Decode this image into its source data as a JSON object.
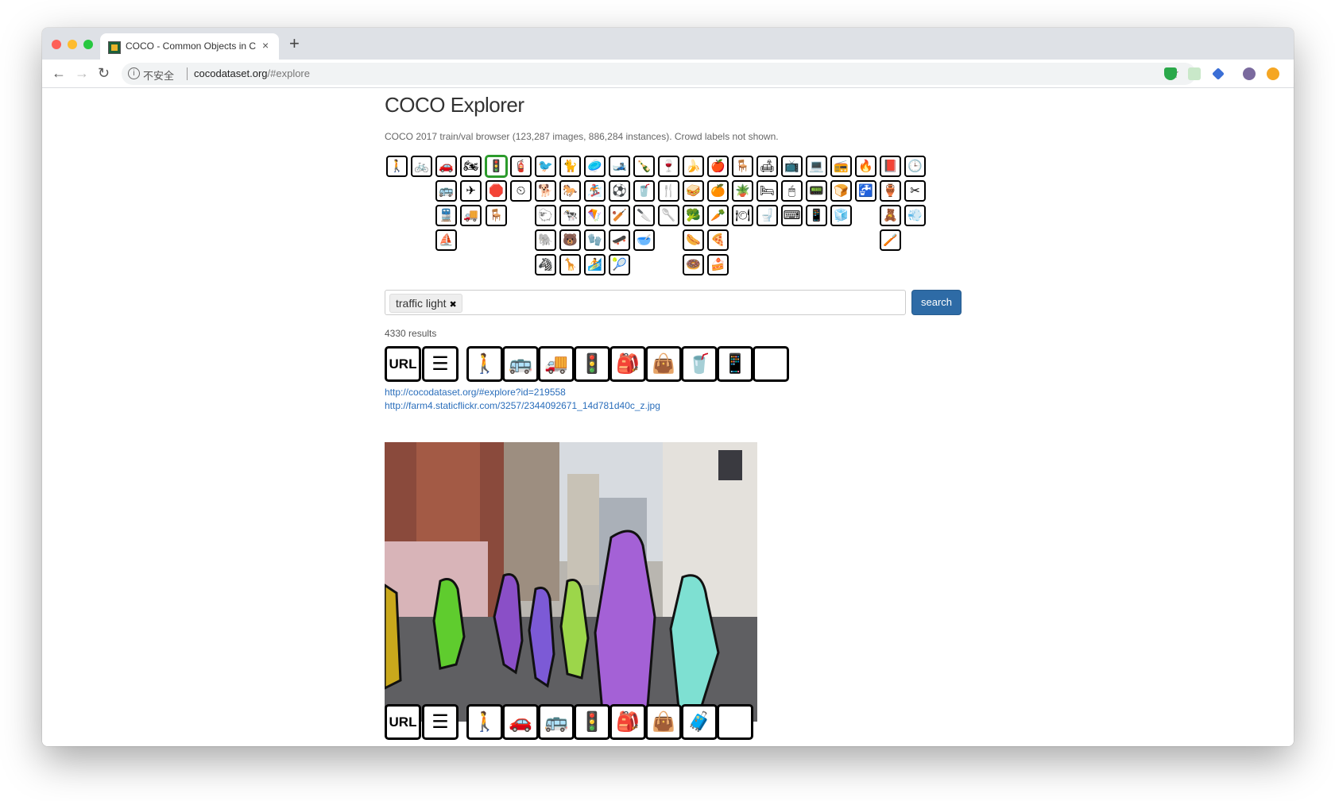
{
  "browser": {
    "tab_title": "COCO - Common Objects in C",
    "new_tab": "+",
    "tab_close": "×",
    "insecure_label": "不安全",
    "url_host": "cocodataset.org",
    "url_path": "/#explore"
  },
  "page": {
    "title": "COCO Explorer",
    "subtitle": "COCO 2017 train/val browser (123,287 images, 886,284 instances). Crowd labels not shown."
  },
  "categories": [
    {
      "name": "person",
      "icon": "🚶"
    },
    {
      "name": "bicycle",
      "icon": "🚲"
    },
    {
      "name": "car",
      "icon": "🚗"
    },
    {
      "name": "motorcycle",
      "icon": "🏍"
    },
    {
      "name": "airplane",
      "icon": "✈"
    },
    {
      "name": "bus",
      "icon": "🚌"
    },
    {
      "name": "train",
      "icon": "🚆"
    },
    {
      "name": "truck",
      "icon": "🚚"
    },
    {
      "name": "boat",
      "icon": "⛵"
    },
    {
      "name": "traffic light",
      "icon": "🚦",
      "selected": true
    },
    {
      "name": "fire hydrant",
      "icon": "🧯"
    },
    {
      "name": "stop sign",
      "icon": "🛑"
    },
    {
      "name": "parking meter",
      "icon": "⏲"
    },
    {
      "name": "bench",
      "icon": "🪑"
    },
    {
      "name": "bird",
      "icon": "🐦"
    },
    {
      "name": "cat",
      "icon": "🐈"
    },
    {
      "name": "dog",
      "icon": "🐕"
    },
    {
      "name": "horse",
      "icon": "🐎"
    },
    {
      "name": "sheep",
      "icon": "🐑"
    },
    {
      "name": "cow",
      "icon": "🐄"
    },
    {
      "name": "elephant",
      "icon": "🐘"
    },
    {
      "name": "bear",
      "icon": "🐻"
    },
    {
      "name": "zebra",
      "icon": "🦓"
    },
    {
      "name": "giraffe",
      "icon": "🦒"
    },
    {
      "name": "frisbee",
      "icon": "🥏"
    },
    {
      "name": "skis",
      "icon": "🎿"
    },
    {
      "name": "snowboard",
      "icon": "🏂"
    },
    {
      "name": "sports ball",
      "icon": "⚽"
    },
    {
      "name": "kite",
      "icon": "🪁"
    },
    {
      "name": "baseball bat",
      "icon": "🏏"
    },
    {
      "name": "baseball glove",
      "icon": "🧤"
    },
    {
      "name": "skateboard",
      "icon": "🛹"
    },
    {
      "name": "surfboard",
      "icon": "🏄"
    },
    {
      "name": "tennis racket",
      "icon": "🎾"
    },
    {
      "name": "bottle",
      "icon": "🍾"
    },
    {
      "name": "wine glass",
      "icon": "🍷"
    },
    {
      "name": "cup",
      "icon": "🥤"
    },
    {
      "name": "fork",
      "icon": "🍴"
    },
    {
      "name": "knife",
      "icon": "🔪"
    },
    {
      "name": "spoon",
      "icon": "🥄"
    },
    {
      "name": "bowl",
      "icon": "🥣"
    },
    {
      "name": "banana",
      "icon": "🍌"
    },
    {
      "name": "apple",
      "icon": "🍎"
    },
    {
      "name": "sandwich",
      "icon": "🥪"
    },
    {
      "name": "orange",
      "icon": "🍊"
    },
    {
      "name": "broccoli",
      "icon": "🥦"
    },
    {
      "name": "carrot",
      "icon": "🥕"
    },
    {
      "name": "hot dog",
      "icon": "🌭"
    },
    {
      "name": "pizza",
      "icon": "🍕"
    },
    {
      "name": "donut",
      "icon": "🍩"
    },
    {
      "name": "cake",
      "icon": "🍰"
    },
    {
      "name": "chair",
      "icon": "🪑"
    },
    {
      "name": "couch",
      "icon": "🛋"
    },
    {
      "name": "potted plant",
      "icon": "🪴"
    },
    {
      "name": "bed",
      "icon": "🛏"
    },
    {
      "name": "dining table",
      "icon": "🍽"
    },
    {
      "name": "toilet",
      "icon": "🚽"
    },
    {
      "name": "tv",
      "icon": "📺"
    },
    {
      "name": "laptop",
      "icon": "💻"
    },
    {
      "name": "mouse",
      "icon": "🖱"
    },
    {
      "name": "remote",
      "icon": "📟"
    },
    {
      "name": "keyboard",
      "icon": "⌨"
    },
    {
      "name": "cell phone",
      "icon": "📱"
    },
    {
      "name": "microwave",
      "icon": "📻"
    },
    {
      "name": "oven",
      "icon": "🔥"
    },
    {
      "name": "toaster",
      "icon": "🍞"
    },
    {
      "name": "sink",
      "icon": "🚰"
    },
    {
      "name": "refrigerator",
      "icon": "🧊"
    },
    {
      "name": "book",
      "icon": "📕"
    },
    {
      "name": "clock",
      "icon": "🕒"
    },
    {
      "name": "vase",
      "icon": "🏺"
    },
    {
      "name": "scissors",
      "icon": "✂"
    },
    {
      "name": "teddy bear",
      "icon": "🧸"
    },
    {
      "name": "hair drier",
      "icon": "💨"
    },
    {
      "name": "toothbrush",
      "icon": "🪥"
    }
  ],
  "search": {
    "tag_label": "traffic light",
    "tag_remove": "✖",
    "button_label": "search"
  },
  "results_count": "4330 results",
  "result1": {
    "url_label": "URL",
    "caption_icon": "☰",
    "object_icons": [
      "🚶",
      "🚌",
      "🚚",
      "🚦",
      "🎒",
      "👜",
      "🥤",
      "📱",
      ""
    ],
    "link1": "http://cocodataset.org/#explore?id=219558",
    "link2": "http://farm4.staticflickr.com/3257/2344092671_14d781d40c_z.jpg"
  },
  "result2": {
    "url_label": "URL",
    "caption_icon": "☰",
    "object_icons": [
      "🚶",
      "🚗",
      "🚌",
      "🚦",
      "🎒",
      "👜",
      "🧳",
      ""
    ]
  },
  "colors": {
    "accent_button": "#2e6ba6",
    "link": "#2a6ebb",
    "selected_border": "#2c9b2c"
  }
}
